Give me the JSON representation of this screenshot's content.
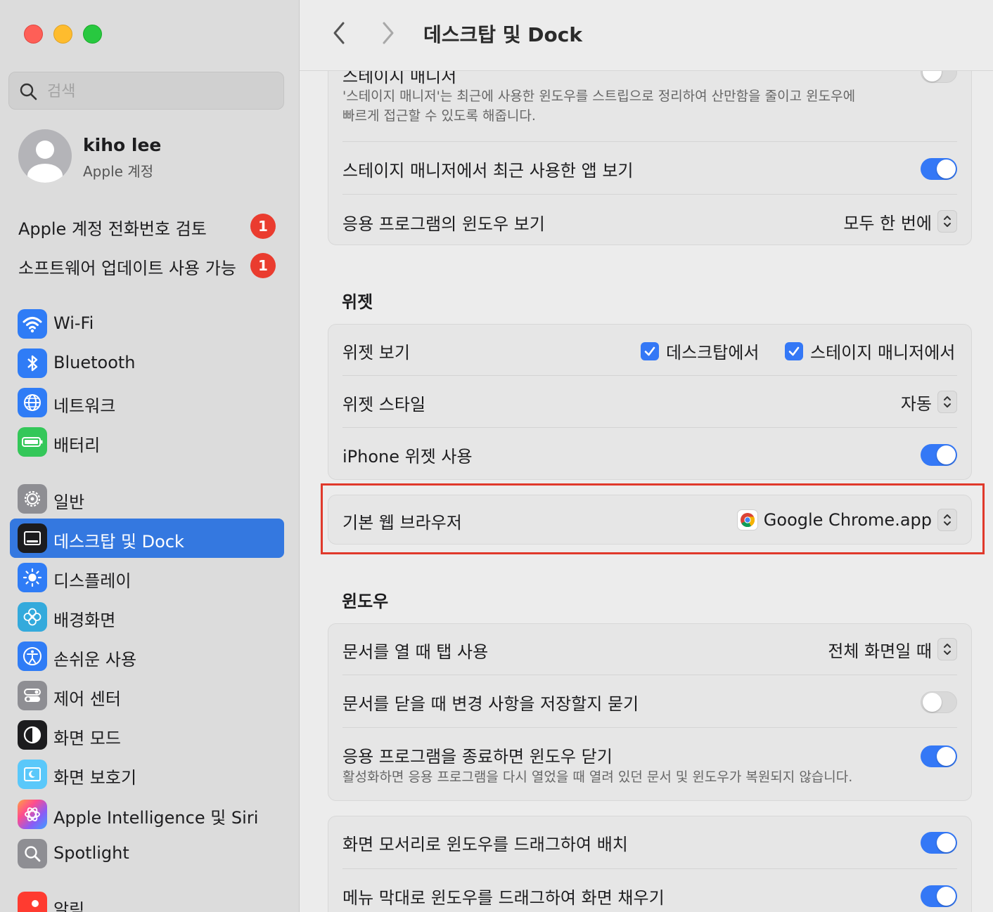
{
  "sidebar": {
    "search": {
      "placeholder": "검색",
      "value": ""
    },
    "profile": {
      "name": "kiho lee",
      "subtitle": "Apple 계정"
    },
    "notices": [
      {
        "label": "Apple 계정 전화번호 검토",
        "badge": "1"
      },
      {
        "label": "소프트웨어 업데이트 사용 가능",
        "badge": "1"
      }
    ],
    "items": [
      {
        "label": "Wi-Fi",
        "icon": "wifi-icon",
        "color": "#2f7cf6"
      },
      {
        "label": "Bluetooth",
        "icon": "bluetooth-icon",
        "color": "#2f7cf6"
      },
      {
        "label": "네트워크",
        "icon": "globe-icon",
        "color": "#2f7cf6"
      },
      {
        "label": "배터리",
        "icon": "battery-icon",
        "color": "#34c759"
      },
      {
        "label": "일반",
        "icon": "gear-icon",
        "color": "#8e8e93"
      },
      {
        "label": "데스크탑 및 Dock",
        "icon": "dock-icon",
        "color": "#1c1c1e",
        "active": true
      },
      {
        "label": "디스플레이",
        "icon": "sun-icon",
        "color": "#2f7cf6"
      },
      {
        "label": "배경화면",
        "icon": "flower-icon",
        "color": "#34aadc"
      },
      {
        "label": "손쉬운 사용",
        "icon": "accessibility-icon",
        "color": "#2f7cf6"
      },
      {
        "label": "제어 센터",
        "icon": "control-center-icon",
        "color": "#8e8e93"
      },
      {
        "label": "화면 모드",
        "icon": "appearance-icon",
        "color": "#1c1c1e"
      },
      {
        "label": "화면 보호기",
        "icon": "screensaver-icon",
        "color": "#5ac8fa"
      },
      {
        "label": "Apple Intelligence 및 Siri",
        "icon": "siri-icon",
        "color": "#ff6b9a"
      },
      {
        "label": "Spotlight",
        "icon": "magnifier-icon",
        "color": "#8e8e93"
      },
      {
        "label": "알림",
        "icon": "bell-icon",
        "color": "#ff3b30"
      }
    ]
  },
  "header": {
    "title": "데스크탑 및 Dock"
  },
  "stage": {
    "title_partial": "스테이지 매니저",
    "desc_line1": "'스테이지 매니저'는 최근에 사용한 윈도우를 스트립으로 정리하여 산만함을 줄이고 윈도우에",
    "desc_line2": "빠르게 접근할 수 있도록 해줍니다.",
    "recent_apps_label": "스테이지 매니저에서 최근 사용한 앱 보기",
    "app_windows_label": "응용 프로그램의 윈도우 보기",
    "app_windows_value": "모두 한 번에"
  },
  "widgets": {
    "section": "위젯",
    "show_label": "위젯 보기",
    "check_desktop": "데스크탑에서",
    "check_stage": "스테이지 매니저에서",
    "style_label": "위젯 스타일",
    "style_value": "자동",
    "iphone_label": "iPhone 위젯 사용"
  },
  "browser": {
    "label": "기본 웹 브라우저",
    "value": "Google Chrome.app"
  },
  "windows": {
    "section": "윈도우",
    "tabs_label": "문서를 열 때 탭 사용",
    "tabs_value": "전체 화면일 때",
    "ask_save_label": "문서를 닫을 때 변경 사항을 저장할지 묻기",
    "close_label": "응용 프로그램을 종료하면 윈도우 닫기",
    "close_desc": "활성화하면 응용 프로그램을 다시 열었을 때 열려 있던 문서 및 윈도우가 복원되지 않습니다.",
    "drag_corners_label": "화면 모서리로 윈도우를 드래그하여 배치",
    "drag_menubar_label": "메뉴 막대로 윈도우를 드래그하여 화면 채우기"
  }
}
